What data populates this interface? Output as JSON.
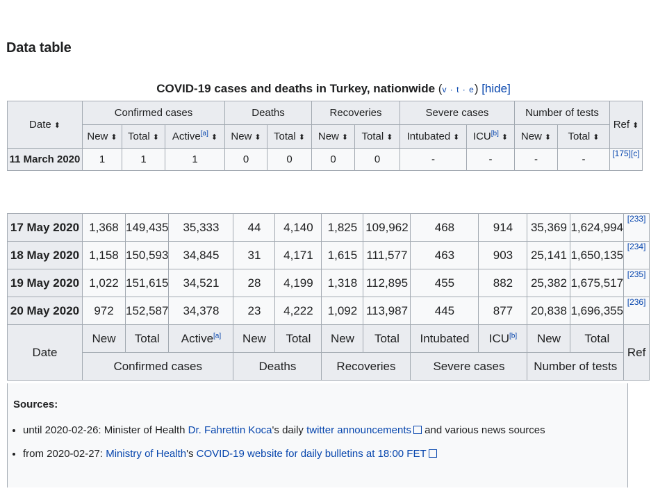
{
  "heading": "Data table",
  "caption": {
    "title": "COVID-19 cases and deaths in Turkey, nationwide",
    "vte": "v · t · e",
    "hide": "[hide]"
  },
  "columns": {
    "date": "Date",
    "ref": "Ref",
    "groups": [
      "Confirmed cases",
      "Deaths",
      "Recoveries",
      "Severe cases",
      "Number of tests"
    ],
    "new": "New",
    "total": "Total",
    "active": "Active",
    "active_note": "[a]",
    "intubated": "Intubated",
    "icu": "ICU",
    "icu_note": "[b]"
  },
  "top_row": {
    "date": "11 March 2020",
    "cells": [
      "1",
      "1",
      "1",
      "0",
      "0",
      "0",
      "0",
      "-",
      "-",
      "-",
      "-"
    ],
    "ref": "[175][c]"
  },
  "rows": [
    {
      "date": "17 May 2020",
      "cells": [
        "1,368",
        "149,435",
        "35,333",
        "44",
        "4,140",
        "1,825",
        "109,962",
        "468",
        "914",
        "35,369",
        "1,624,994"
      ],
      "ref": "[233]"
    },
    {
      "date": "18 May 2020",
      "cells": [
        "1,158",
        "150,593",
        "34,845",
        "31",
        "4,171",
        "1,615",
        "111,577",
        "463",
        "903",
        "25,141",
        "1,650,135"
      ],
      "ref": "[234]"
    },
    {
      "date": "19 May 2020",
      "cells": [
        "1,022",
        "151,615",
        "34,521",
        "28",
        "4,199",
        "1,318",
        "112,895",
        "455",
        "882",
        "25,382",
        "1,675,517"
      ],
      "ref": "[235]"
    },
    {
      "date": "20 May 2020",
      "cells": [
        "972",
        "152,587",
        "34,378",
        "23",
        "4,222",
        "1,092",
        "113,987",
        "445",
        "877",
        "20,838",
        "1,696,355"
      ],
      "ref": "[236]"
    }
  ],
  "sources": {
    "title": "Sources:",
    "item1": {
      "pre": "until 2020-02-26: Minister of Health ",
      "link1": "Dr. Fahrettin Koca",
      "mid": "'s daily ",
      "link2": "twitter announcements",
      "post": " and various news sources"
    },
    "item2": {
      "pre": "from 2020-02-27: ",
      "link1": "Ministry of Health",
      "mid": "'s ",
      "link2": "COVID-19 website for daily bulletins at 18:00 FET"
    }
  }
}
